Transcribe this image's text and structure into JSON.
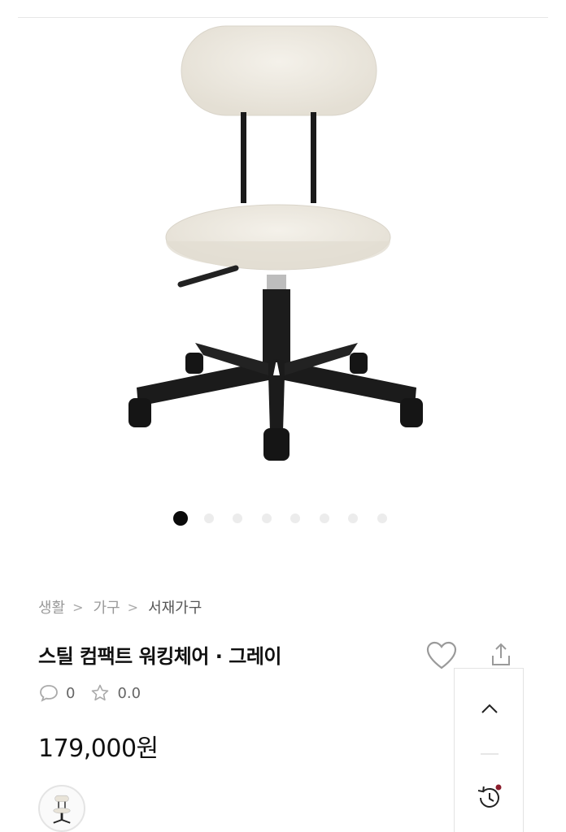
{
  "product": {
    "image_icon": "office-chair-photo",
    "gallery_count": 8,
    "gallery_active": 1,
    "breadcrumb": [
      {
        "label": "생활"
      },
      {
        "label": "가구"
      },
      {
        "label": "서재가구"
      }
    ],
    "name": "스틸 컴팩트 워킹체어 · 그레이",
    "review_count": "0",
    "rating": "0.0",
    "price": "179,000원",
    "thumbnail_icon": "chair-thumbnail"
  },
  "icons": {
    "wishlist": "heart-icon",
    "share": "share-icon",
    "comment": "speech-bubble-icon",
    "star": "star-icon",
    "scroll_top": "chevron-up-icon",
    "recent": "history-clock-icon"
  },
  "colors": {
    "accent_dot": "#8b1c2c",
    "text_primary": "#111111",
    "text_muted": "#999999"
  }
}
